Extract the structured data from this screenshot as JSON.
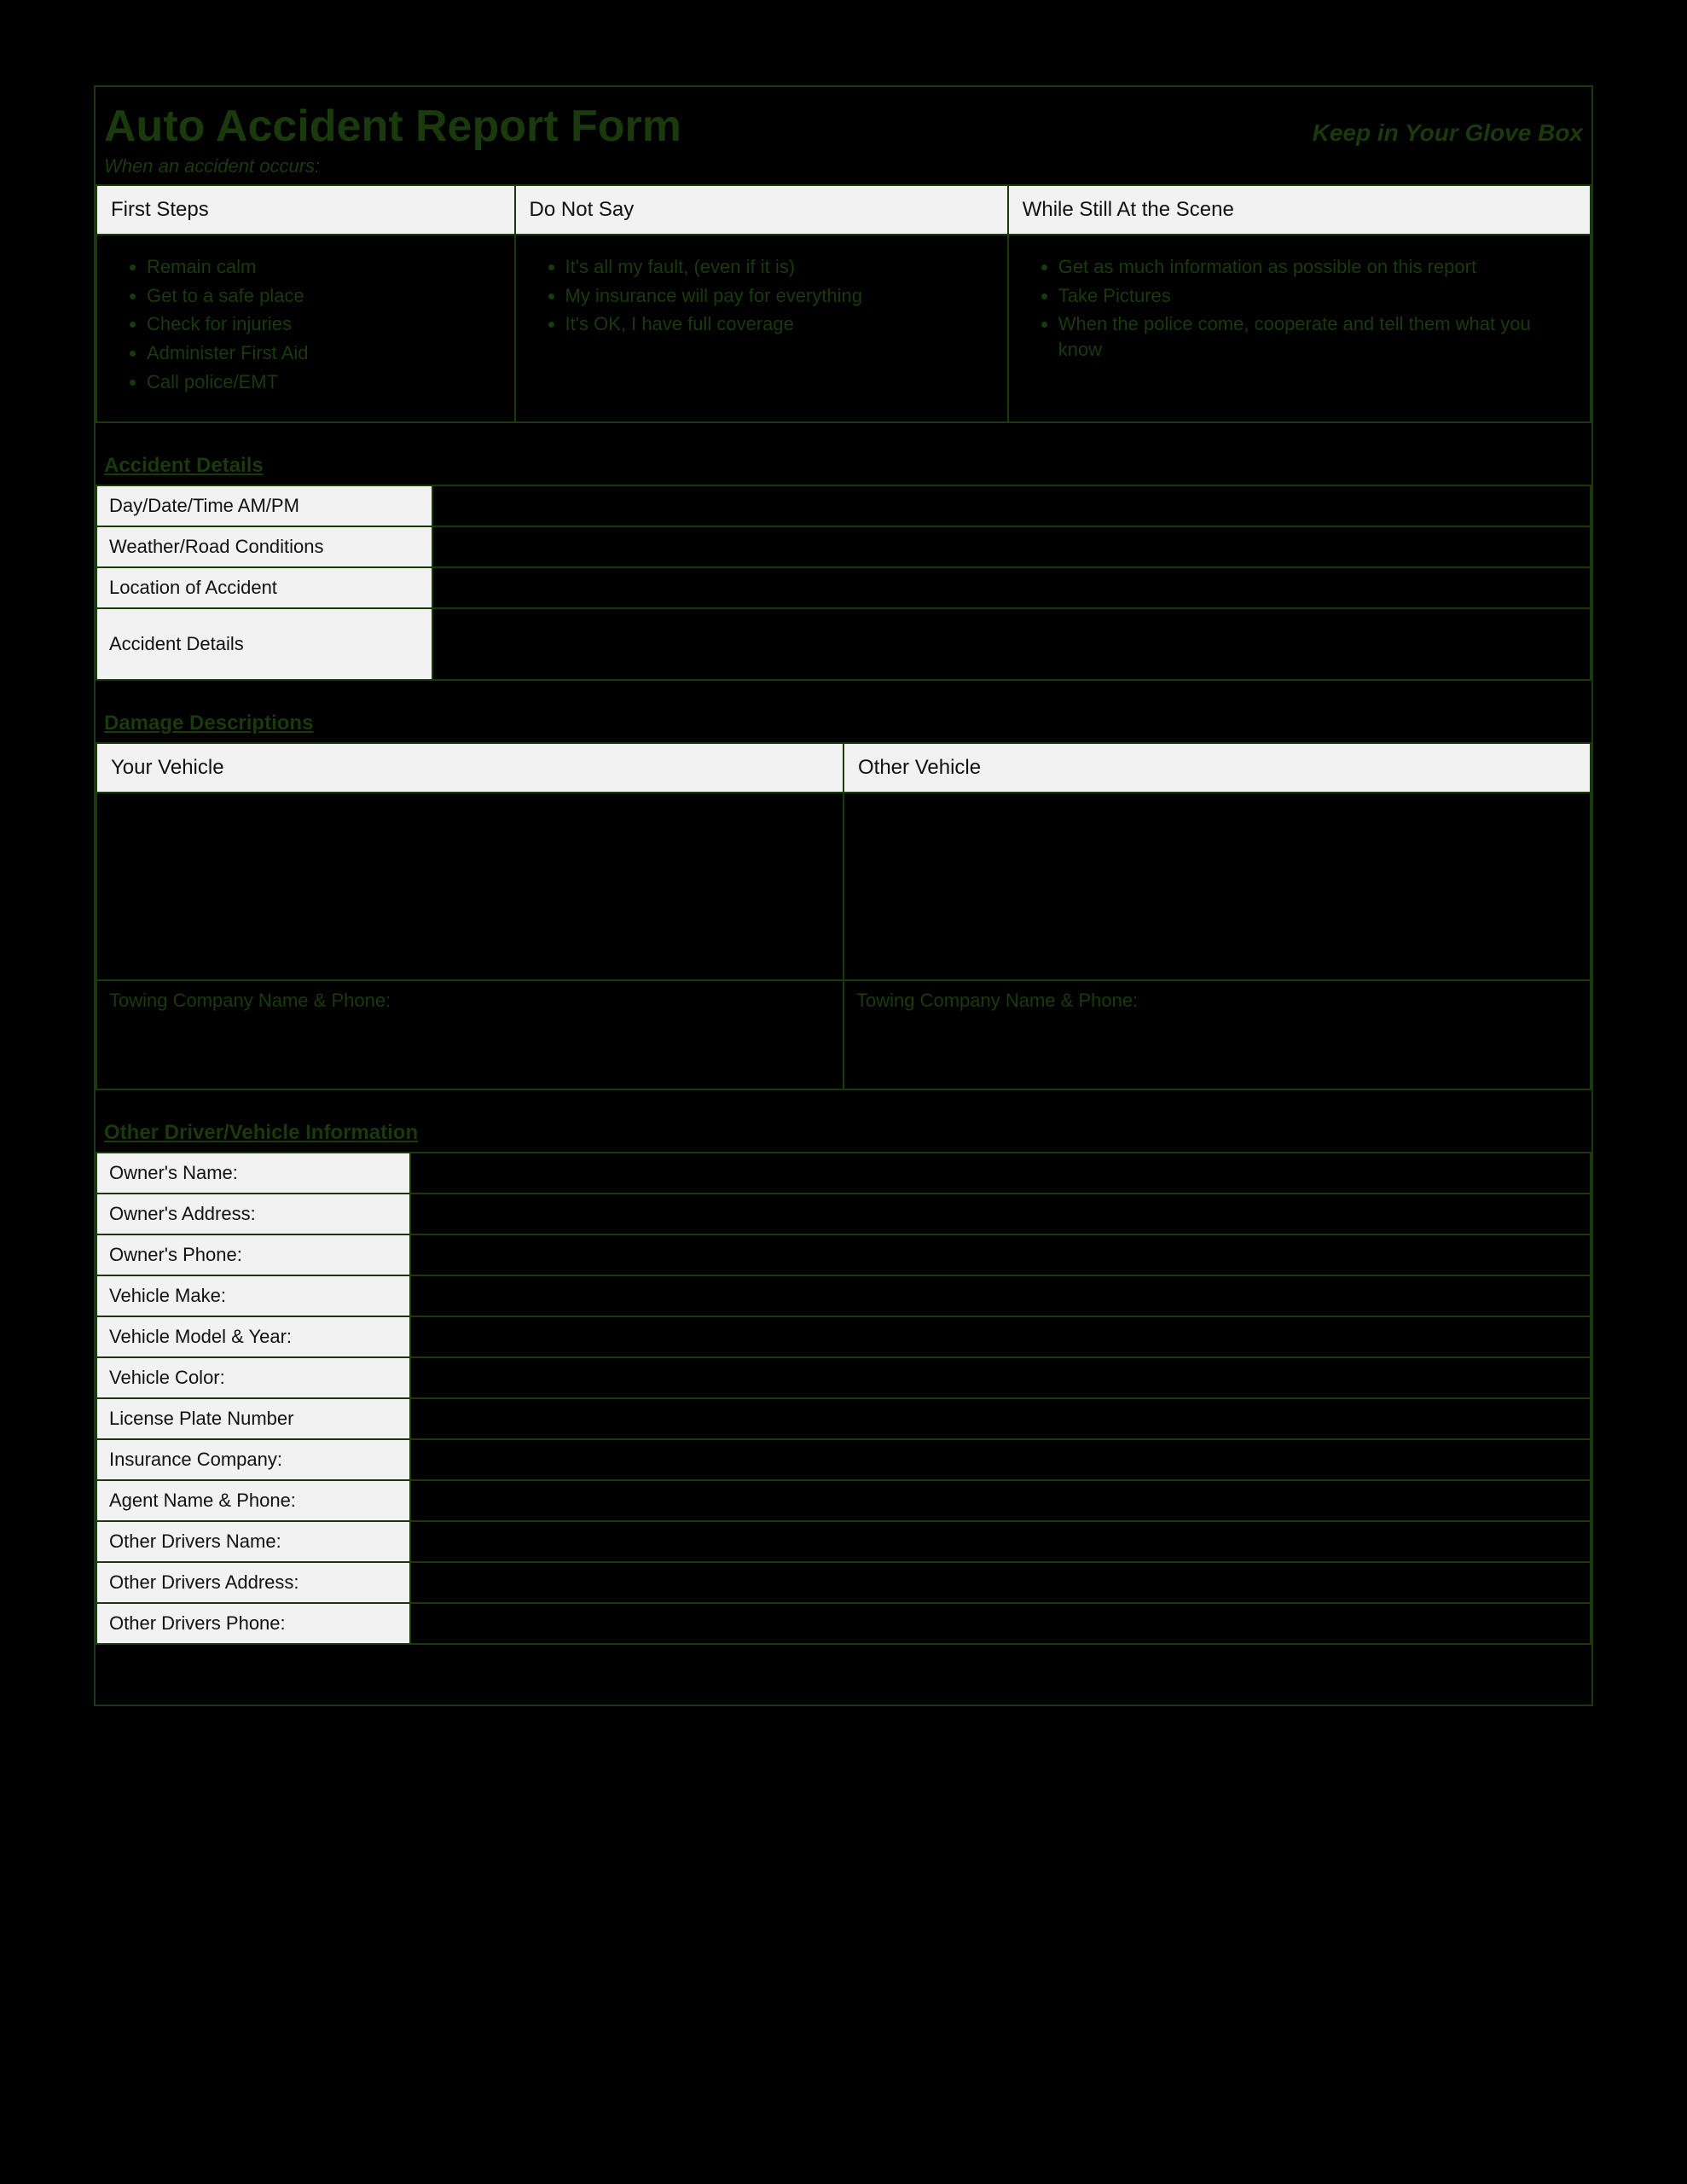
{
  "header": {
    "title": "Auto Accident Report Form",
    "right": "Keep in Your Glove Box",
    "sub": "When an accident occurs:"
  },
  "info": {
    "col1_head": "First Steps",
    "col2_head": "Do Not Say",
    "col3_head": "While Still At the Scene",
    "first_steps": {
      "i0": "Remain calm",
      "i1": "Get to a safe place",
      "i2": "Check for injuries",
      "i3": "Administer First Aid",
      "i4": "Call police/EMT"
    },
    "do_not_say": {
      "i0": "It's all my fault, (even if it is)",
      "i1": "My insurance will pay for everything",
      "i2": "It's OK, I have full coverage"
    },
    "at_scene": {
      "i0": "Get as much information as possible on this report",
      "i1": "Take Pictures",
      "i2": "When the police come, cooperate and tell them what you know"
    }
  },
  "accident": {
    "title": "Accident Details",
    "rows": {
      "daydate": "Day/Date/Time AM/PM",
      "weather": "Weather/Road Conditions",
      "location": "Location of Accident",
      "details": "Accident Details"
    }
  },
  "damage": {
    "title": "Damage Descriptions",
    "your": "Your Vehicle",
    "other": "Other Vehicle",
    "tow_your": "Towing Company Name & Phone:",
    "tow_other": "Towing Company Name & Phone:"
  },
  "odv": {
    "title": "Other Driver/Vehicle Information",
    "rows": {
      "r0": "Owner's Name:",
      "r1": "Owner's Address:",
      "r2": "Owner's Phone:",
      "r3": "Vehicle Make:",
      "r4": "Vehicle Model & Year:",
      "r5": "Vehicle Color:",
      "r6": "License Plate Number",
      "r7": "Insurance Company:",
      "r8": "Agent Name & Phone:",
      "r9": "Other Drivers Name:",
      "r10": "Other Drivers Address:",
      "r11": "Other Drivers Phone:"
    }
  }
}
